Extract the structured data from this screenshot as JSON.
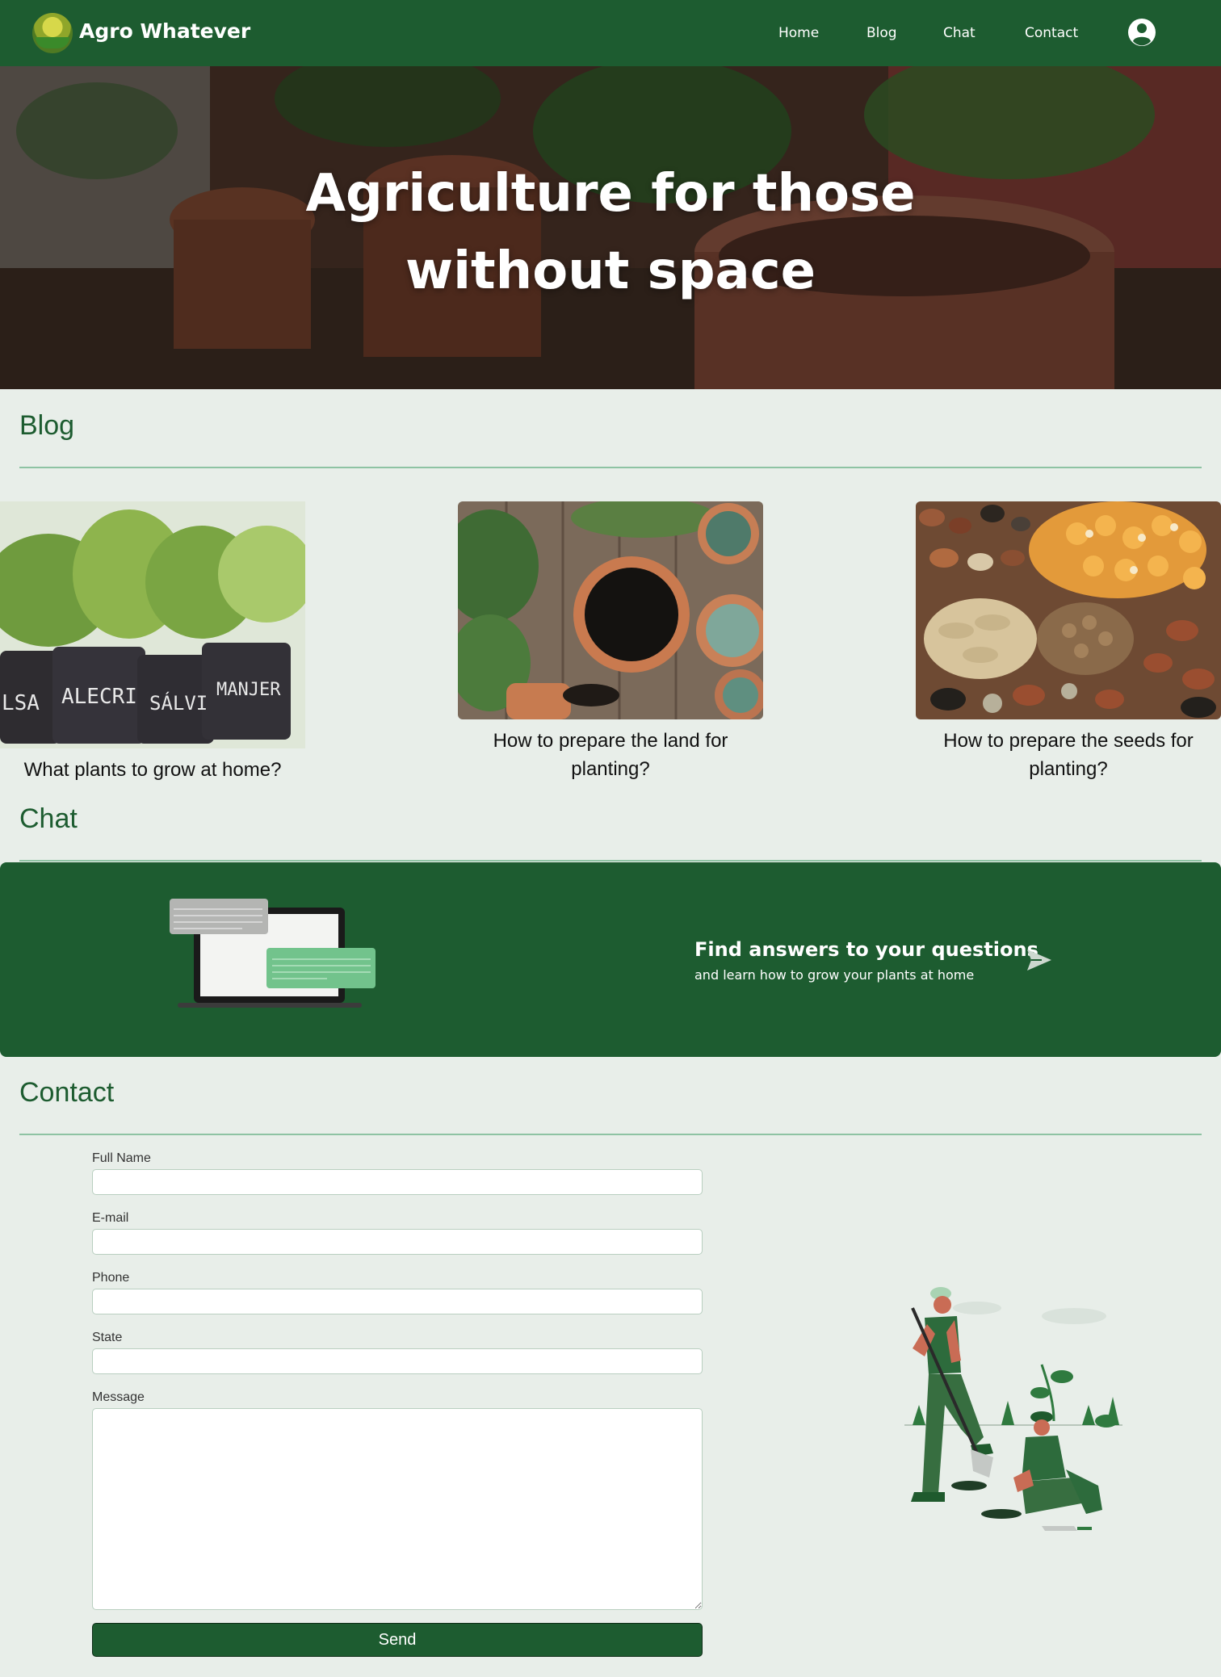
{
  "header": {
    "brand": "Agro Whatever",
    "nav": [
      "Home",
      "Blog",
      "Chat",
      "Contact"
    ]
  },
  "hero": {
    "title_line1": "Agriculture for those",
    "title_line2": "without space"
  },
  "blog": {
    "title": "Blog",
    "posts": [
      {
        "title": "What plants to grow at home?",
        "image": "potted-herbs-image",
        "pot_labels": [
          "LSA",
          "ALECRI",
          "SÁLVI",
          "MANJER"
        ]
      },
      {
        "title_line1": "How to prepare the land for",
        "title_line2": "planting?",
        "image": "soil-pot-image"
      },
      {
        "title_line1": "How to prepare the seeds for",
        "title_line2": "planting?",
        "image": "seeds-image"
      }
    ]
  },
  "chat": {
    "title": "Chat",
    "heading": "Find answers to your questions",
    "subheading": "and learn how to grow your plants at home",
    "icon": "send-icon"
  },
  "contact": {
    "title": "Contact",
    "fields": {
      "full_name": {
        "label": "Full Name",
        "value": ""
      },
      "email": {
        "label": "E-mail",
        "value": ""
      },
      "phone": {
        "label": "Phone",
        "value": ""
      },
      "state": {
        "label": "State",
        "value": ""
      },
      "message": {
        "label": "Message",
        "value": ""
      }
    },
    "submit_label": "Send"
  },
  "colors": {
    "primary": "#1d5c30",
    "background": "#e8eee9",
    "rule": "#8ec3a3"
  }
}
